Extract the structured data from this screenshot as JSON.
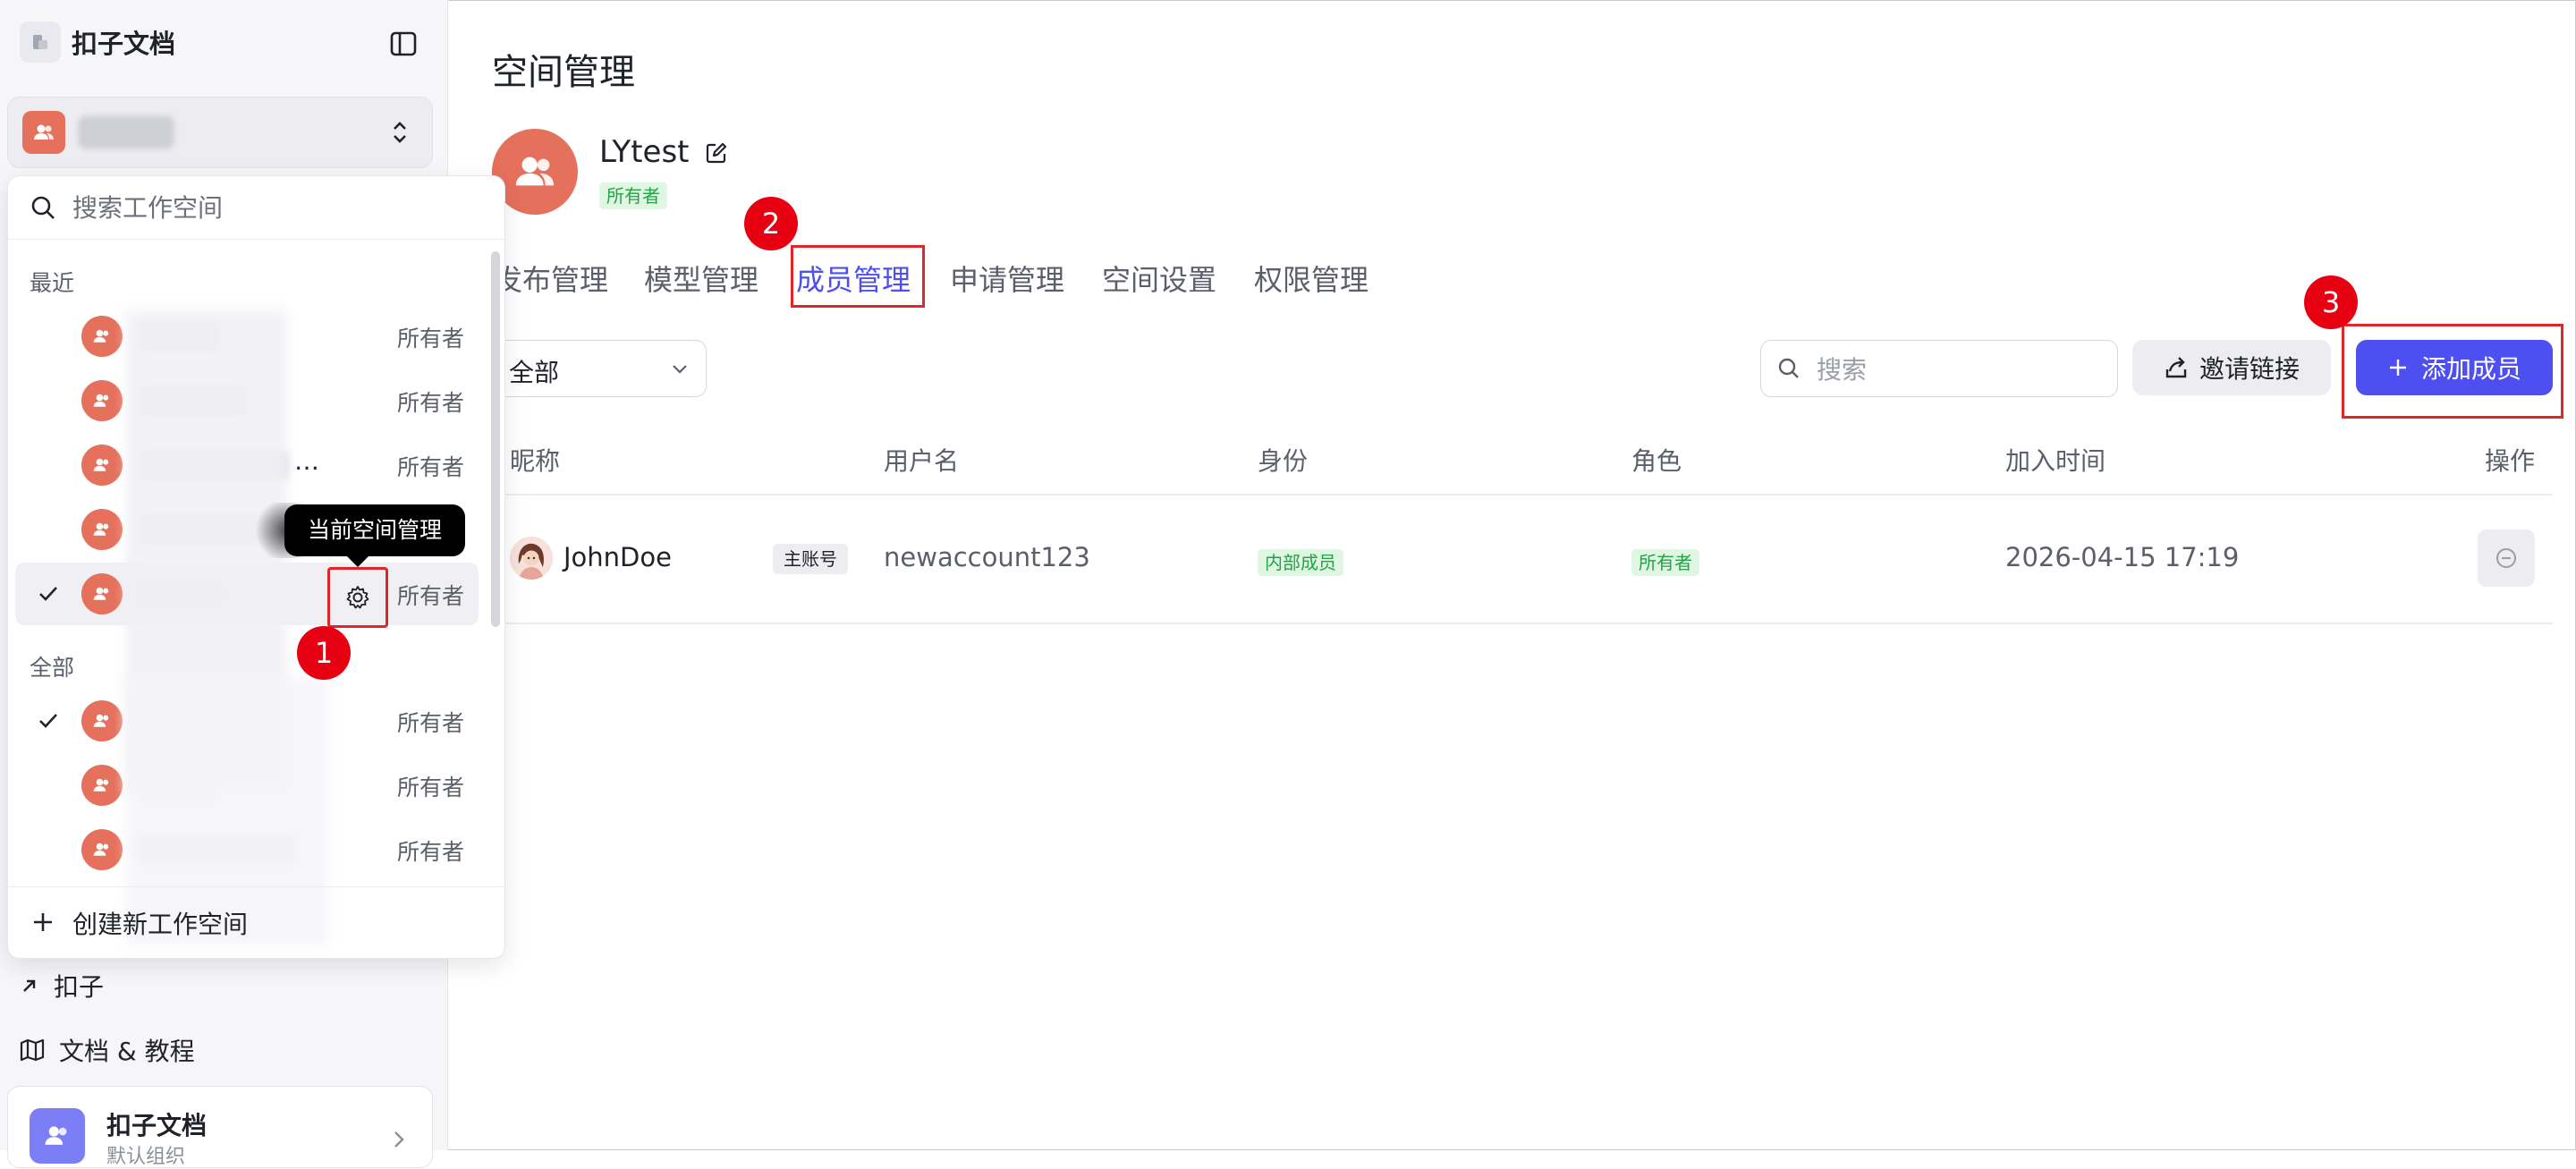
{
  "sidebar": {
    "brand_title": "扣子文档",
    "links": [
      {
        "label": "扣子"
      },
      {
        "label": "文档 & 教程"
      }
    ],
    "card": {
      "title": "扣子文档",
      "subtitle": "默认组织"
    }
  },
  "workspace_dropdown": {
    "search_placeholder": "搜索工作空间",
    "recent_label": "最近",
    "all_label": "全部",
    "role_label": "所有者",
    "create_label": "创建新工作空间",
    "tooltip": "当前空间管理"
  },
  "annotations": {
    "badge1": "1",
    "badge2": "2",
    "badge3": "3"
  },
  "main": {
    "title": "空间管理",
    "workspace_name": "LYtest",
    "owner_tag": "所有者",
    "tabs": [
      "发布管理",
      "模型管理",
      "成员管理",
      "申请管理",
      "空间设置",
      "权限管理"
    ],
    "active_tab": "成员管理",
    "filter_value": "全部",
    "search_placeholder": "搜索",
    "invite_label": "邀请链接",
    "add_label": "添加成员",
    "columns": [
      "昵称",
      "用户名",
      "身份",
      "角色",
      "加入时间",
      "操作"
    ],
    "rows": [
      {
        "nickname": "JohnDoe",
        "tag": "主账号",
        "username": "newaccount123",
        "identity": "内部成员",
        "role": "所有者",
        "joined": "2026-04-15 17:19"
      }
    ]
  },
  "colors": {
    "accent": "#4e4ff0",
    "avatar": "#e5705c",
    "annotation_red": "#e60012",
    "success": "#23a346"
  }
}
